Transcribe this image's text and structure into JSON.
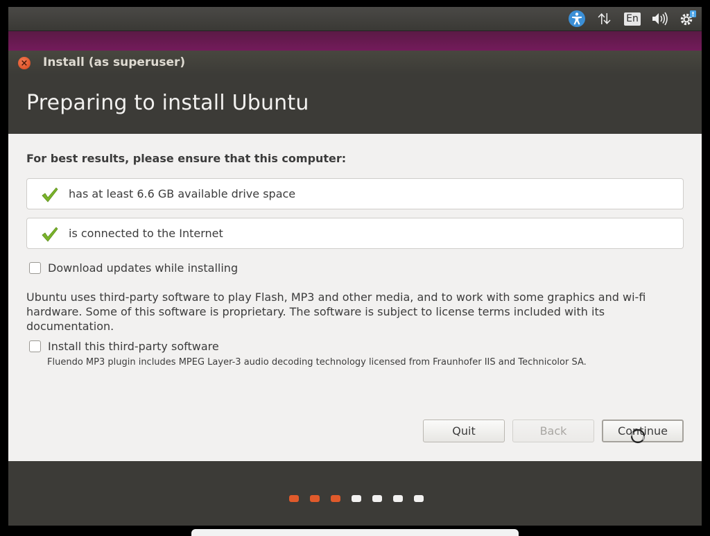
{
  "top_panel": {
    "icons": [
      "accessibility-icon",
      "network-icon",
      "keyboard-layout-icon",
      "sound-icon",
      "system-gear-icon"
    ],
    "keyboard_layout": "En"
  },
  "window": {
    "title": "Install (as superuser)",
    "close_label": "×"
  },
  "header": {
    "title": "Preparing to install Ubuntu"
  },
  "content": {
    "heading": "For best results, please ensure that this computer:",
    "requirements": [
      {
        "text": "has at least 6.6 GB available drive space",
        "met": true
      },
      {
        "text": "is connected to the Internet",
        "met": true
      }
    ],
    "download_updates": {
      "label": "Download updates while installing",
      "checked": false
    },
    "third_party_info": "Ubuntu uses third-party software to play Flash, MP3 and other media, and to work with some graphics and wi-fi hardware. Some of this software is proprietary. The software is subject to license terms included with its documentation.",
    "install_third_party": {
      "label": "Install this third-party software",
      "checked": false
    },
    "mp3_note": "Fluendo MP3 plugin includes MPEG Layer-3 audio decoding technology licensed from Fraunhofer IIS and Technicolor SA."
  },
  "buttons": {
    "quit": "Quit",
    "back": "Back",
    "continue": "Continue"
  },
  "progress": {
    "total_steps": 7,
    "completed_steps": 3,
    "active_color": "#e05a2b",
    "inactive_color": "#f2f1f0"
  },
  "colors": {
    "accent": "#dd4814",
    "check_green": "#7ab42a",
    "desktop_purple": "#6a1b52"
  }
}
